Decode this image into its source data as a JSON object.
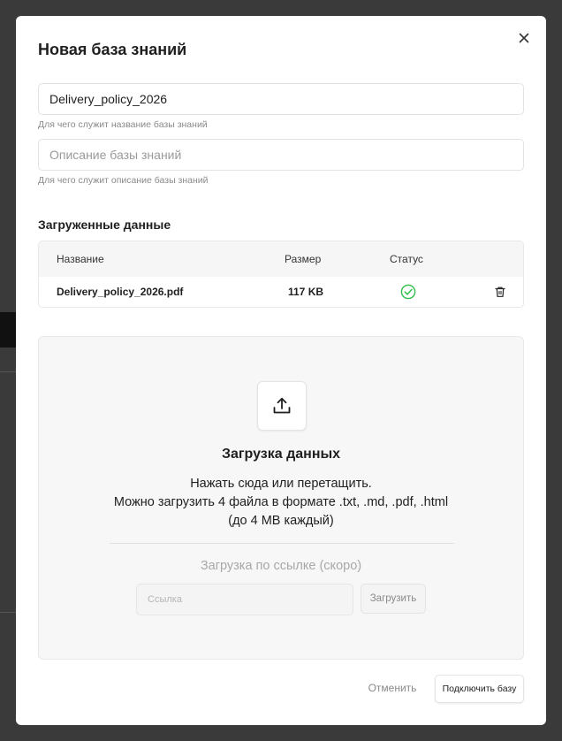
{
  "modal": {
    "title": "Новая база знаний",
    "name_field": {
      "value": "Delivery_policy_2026",
      "hint": "Для чего служит название базы знаний"
    },
    "description_field": {
      "value": "",
      "placeholder": "Описание базы знаний",
      "hint": "Для чего служит описание базы знаний"
    },
    "uploaded": {
      "section_title": "Загруженные данные",
      "columns": [
        "Название",
        "Размер",
        "Статус"
      ],
      "rows": [
        {
          "name": "Delivery_policy_2026.pdf",
          "size": "117 KB",
          "status_icon": "check-circle-icon"
        }
      ]
    },
    "dropzone": {
      "title": "Загрузка данных",
      "line1": "Нажать сюда или перетащить.",
      "line2": "Можно загрузить 4 файла в формате .txt, .md, .pdf, .html",
      "line3": "(до 4 MB каждый)",
      "link_title": "Загрузка по ссылке (скоро)",
      "link_placeholder": "Ссылка",
      "link_button": "Загрузить"
    },
    "footer": {
      "cancel_label": "Отменить",
      "connect_label": "Подключить базу"
    }
  },
  "colors": {
    "success": "#2fbf4a",
    "overlay": "#2f2f2f"
  }
}
